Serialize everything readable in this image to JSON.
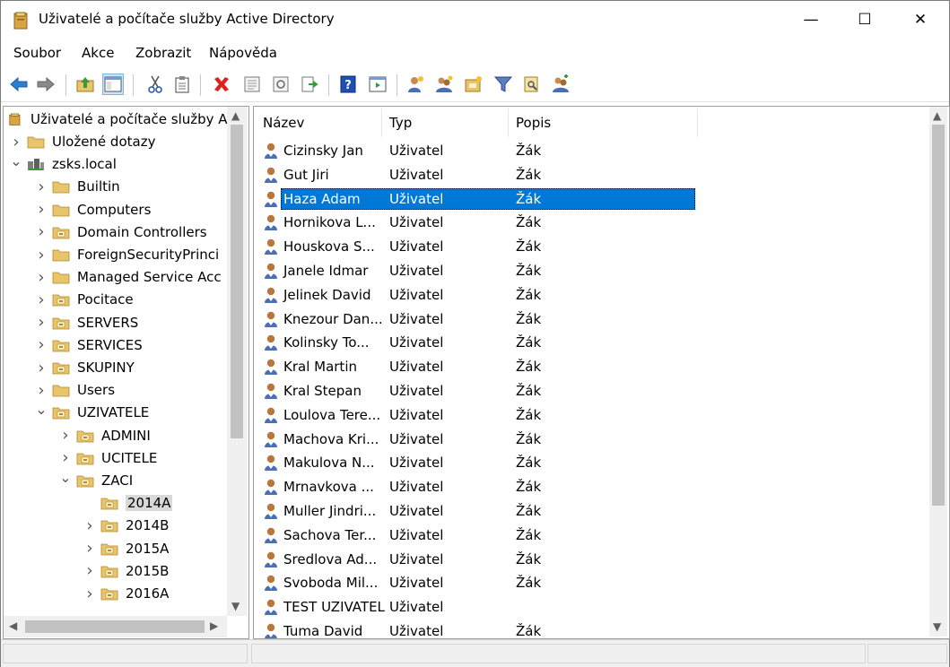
{
  "window": {
    "title": "Uživatelé a počítače služby Active Directory",
    "min_glyph": "—",
    "max_glyph": "☐",
    "close_glyph": "✕"
  },
  "menu": [
    "Soubor",
    "Akce",
    "Zobrazit",
    "Nápověda"
  ],
  "toolbar": {
    "icons": [
      "back-icon",
      "forward-icon",
      "up-folder-icon",
      "show-hide-tree-icon",
      "cut-icon",
      "paste-icon",
      "delete-icon",
      "properties-icon",
      "refresh-icon",
      "export-list-icon",
      "help-icon",
      "console-view-icon",
      "new-user-icon",
      "new-group-icon",
      "new-ou-icon",
      "filter-icon",
      "find-icon",
      "add-to-group-icon"
    ]
  },
  "tree": {
    "root": "Uživatelé a počítače služby A",
    "items": [
      {
        "label": "Uložené dotazy",
        "level": 1,
        "expanded": false
      },
      {
        "label": "zsks.local",
        "level": 1,
        "expanded": true
      },
      {
        "label": "Builtin",
        "level": 2,
        "expanded": false
      },
      {
        "label": "Computers",
        "level": 2,
        "expanded": false
      },
      {
        "label": "Domain Controllers",
        "level": 2,
        "expanded": false
      },
      {
        "label": "ForeignSecurityPrinci",
        "level": 2,
        "expanded": false
      },
      {
        "label": "Managed Service Acc",
        "level": 2,
        "expanded": false
      },
      {
        "label": "Pocitace",
        "level": 2,
        "expanded": false
      },
      {
        "label": "SERVERS",
        "level": 2,
        "expanded": false
      },
      {
        "label": "SERVICES",
        "level": 2,
        "expanded": false
      },
      {
        "label": "SKUPINY",
        "level": 2,
        "expanded": false
      },
      {
        "label": "Users",
        "level": 2,
        "expanded": false
      },
      {
        "label": "UZIVATELE",
        "level": 2,
        "expanded": true
      },
      {
        "label": "ADMINI",
        "level": 3,
        "expanded": false
      },
      {
        "label": "UCITELE",
        "level": 3,
        "expanded": false
      },
      {
        "label": "ZACI",
        "level": 3,
        "expanded": true
      },
      {
        "label": "2014A",
        "level": 4,
        "expanded": null,
        "selected": true
      },
      {
        "label": "2014B",
        "level": 4,
        "expanded": false
      },
      {
        "label": "2015A",
        "level": 4,
        "expanded": false
      },
      {
        "label": "2015B",
        "level": 4,
        "expanded": false
      },
      {
        "label": "2016A",
        "level": 4,
        "expanded": false
      }
    ]
  },
  "list": {
    "columns": [
      "Název",
      "Typ",
      "Popis"
    ],
    "rows": [
      {
        "name": "Cizinsky Jan",
        "type": "Uživatel",
        "desc": "Žák"
      },
      {
        "name": "Gut Jiri",
        "type": "Uživatel",
        "desc": "Žák"
      },
      {
        "name": "Haza Adam",
        "type": "Uživatel",
        "desc": "Žák",
        "selected": true
      },
      {
        "name": "Hornikova L...",
        "type": "Uživatel",
        "desc": "Žák"
      },
      {
        "name": "Houskova S...",
        "type": "Uživatel",
        "desc": "Žák"
      },
      {
        "name": "Janele Idmar",
        "type": "Uživatel",
        "desc": "Žák"
      },
      {
        "name": "Jelinek David",
        "type": "Uživatel",
        "desc": "Žák"
      },
      {
        "name": "Knezour Dan...",
        "type": "Uživatel",
        "desc": "Žák"
      },
      {
        "name": "Kolinsky To...",
        "type": "Uživatel",
        "desc": "Žák"
      },
      {
        "name": "Kral Martin",
        "type": "Uživatel",
        "desc": "Žák"
      },
      {
        "name": "Kral Stepan",
        "type": "Uživatel",
        "desc": "Žák"
      },
      {
        "name": "Loulova Tere...",
        "type": "Uživatel",
        "desc": "Žák"
      },
      {
        "name": "Machova Kri...",
        "type": "Uživatel",
        "desc": "Žák"
      },
      {
        "name": "Makulova N...",
        "type": "Uživatel",
        "desc": "Žák"
      },
      {
        "name": "Mrnavkova ...",
        "type": "Uživatel",
        "desc": "Žák"
      },
      {
        "name": "Muller Jindri...",
        "type": "Uživatel",
        "desc": "Žák"
      },
      {
        "name": "Sachova Ter...",
        "type": "Uživatel",
        "desc": "Žák"
      },
      {
        "name": "Sredlova Ad...",
        "type": "Uživatel",
        "desc": "Žák"
      },
      {
        "name": "Svoboda Mil...",
        "type": "Uživatel",
        "desc": "Žák"
      },
      {
        "name": "TEST UZIVATEL",
        "type": "Uživatel",
        "desc": ""
      },
      {
        "name": "Tuma David",
        "type": "Uživatel",
        "desc": "Žák"
      }
    ]
  },
  "colors": {
    "selection": "#0078d7",
    "tree_selection": "#d9d9d9",
    "folder": "#e8c56a"
  }
}
